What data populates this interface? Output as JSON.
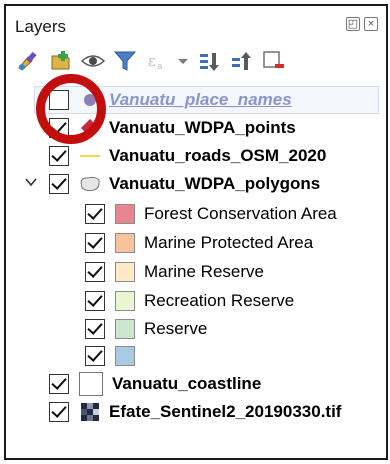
{
  "panel": {
    "title": "Layers",
    "btn_float": "◰",
    "btn_close": "×"
  },
  "toolbar": {
    "icons": [
      "style-icon",
      "add-group-icon",
      "eye-icon",
      "filter-icon",
      "filter-expression-icon",
      "expand-all-icon",
      "collapse-all-icon",
      "remove-layer-icon"
    ]
  },
  "layers": {
    "place_names": {
      "label": "Vanuatu_place_names",
      "checked": false,
      "symbol_color": "#8e7fb2"
    },
    "wdpa_points": {
      "label": "Vanuatu_WDPA_points",
      "checked": true,
      "symbol_color": "#c8283c"
    },
    "roads": {
      "label": "Vanuatu_roads_OSM_2020",
      "checked": true,
      "symbol_color": "#e8d400"
    },
    "wdpa_polygons": {
      "label": "Vanuatu_WDPA_polygons",
      "checked": true,
      "expanded": true,
      "classes": [
        {
          "label": "Forest Conservation Area",
          "color": "#e8858f",
          "checked": true
        },
        {
          "label": "Marine Protected Area",
          "color": "#f6c39c",
          "checked": true
        },
        {
          "label": "Marine Reserve",
          "color": "#fde9c8",
          "checked": true
        },
        {
          "label": "Recreation Reserve",
          "color": "#eaf6d2",
          "checked": true
        },
        {
          "label": "Reserve",
          "color": "#cbe6cf",
          "checked": true
        },
        {
          "label": "",
          "color": "#a9cbe2",
          "checked": true
        }
      ]
    },
    "coastline": {
      "label": "Vanuatu_coastline",
      "checked": true
    },
    "sentinel": {
      "label": "Efate_Sentinel2_20190330.tif",
      "checked": true
    }
  },
  "annotation": {
    "color": "#c40d0d",
    "target": "place-names-checkbox"
  }
}
